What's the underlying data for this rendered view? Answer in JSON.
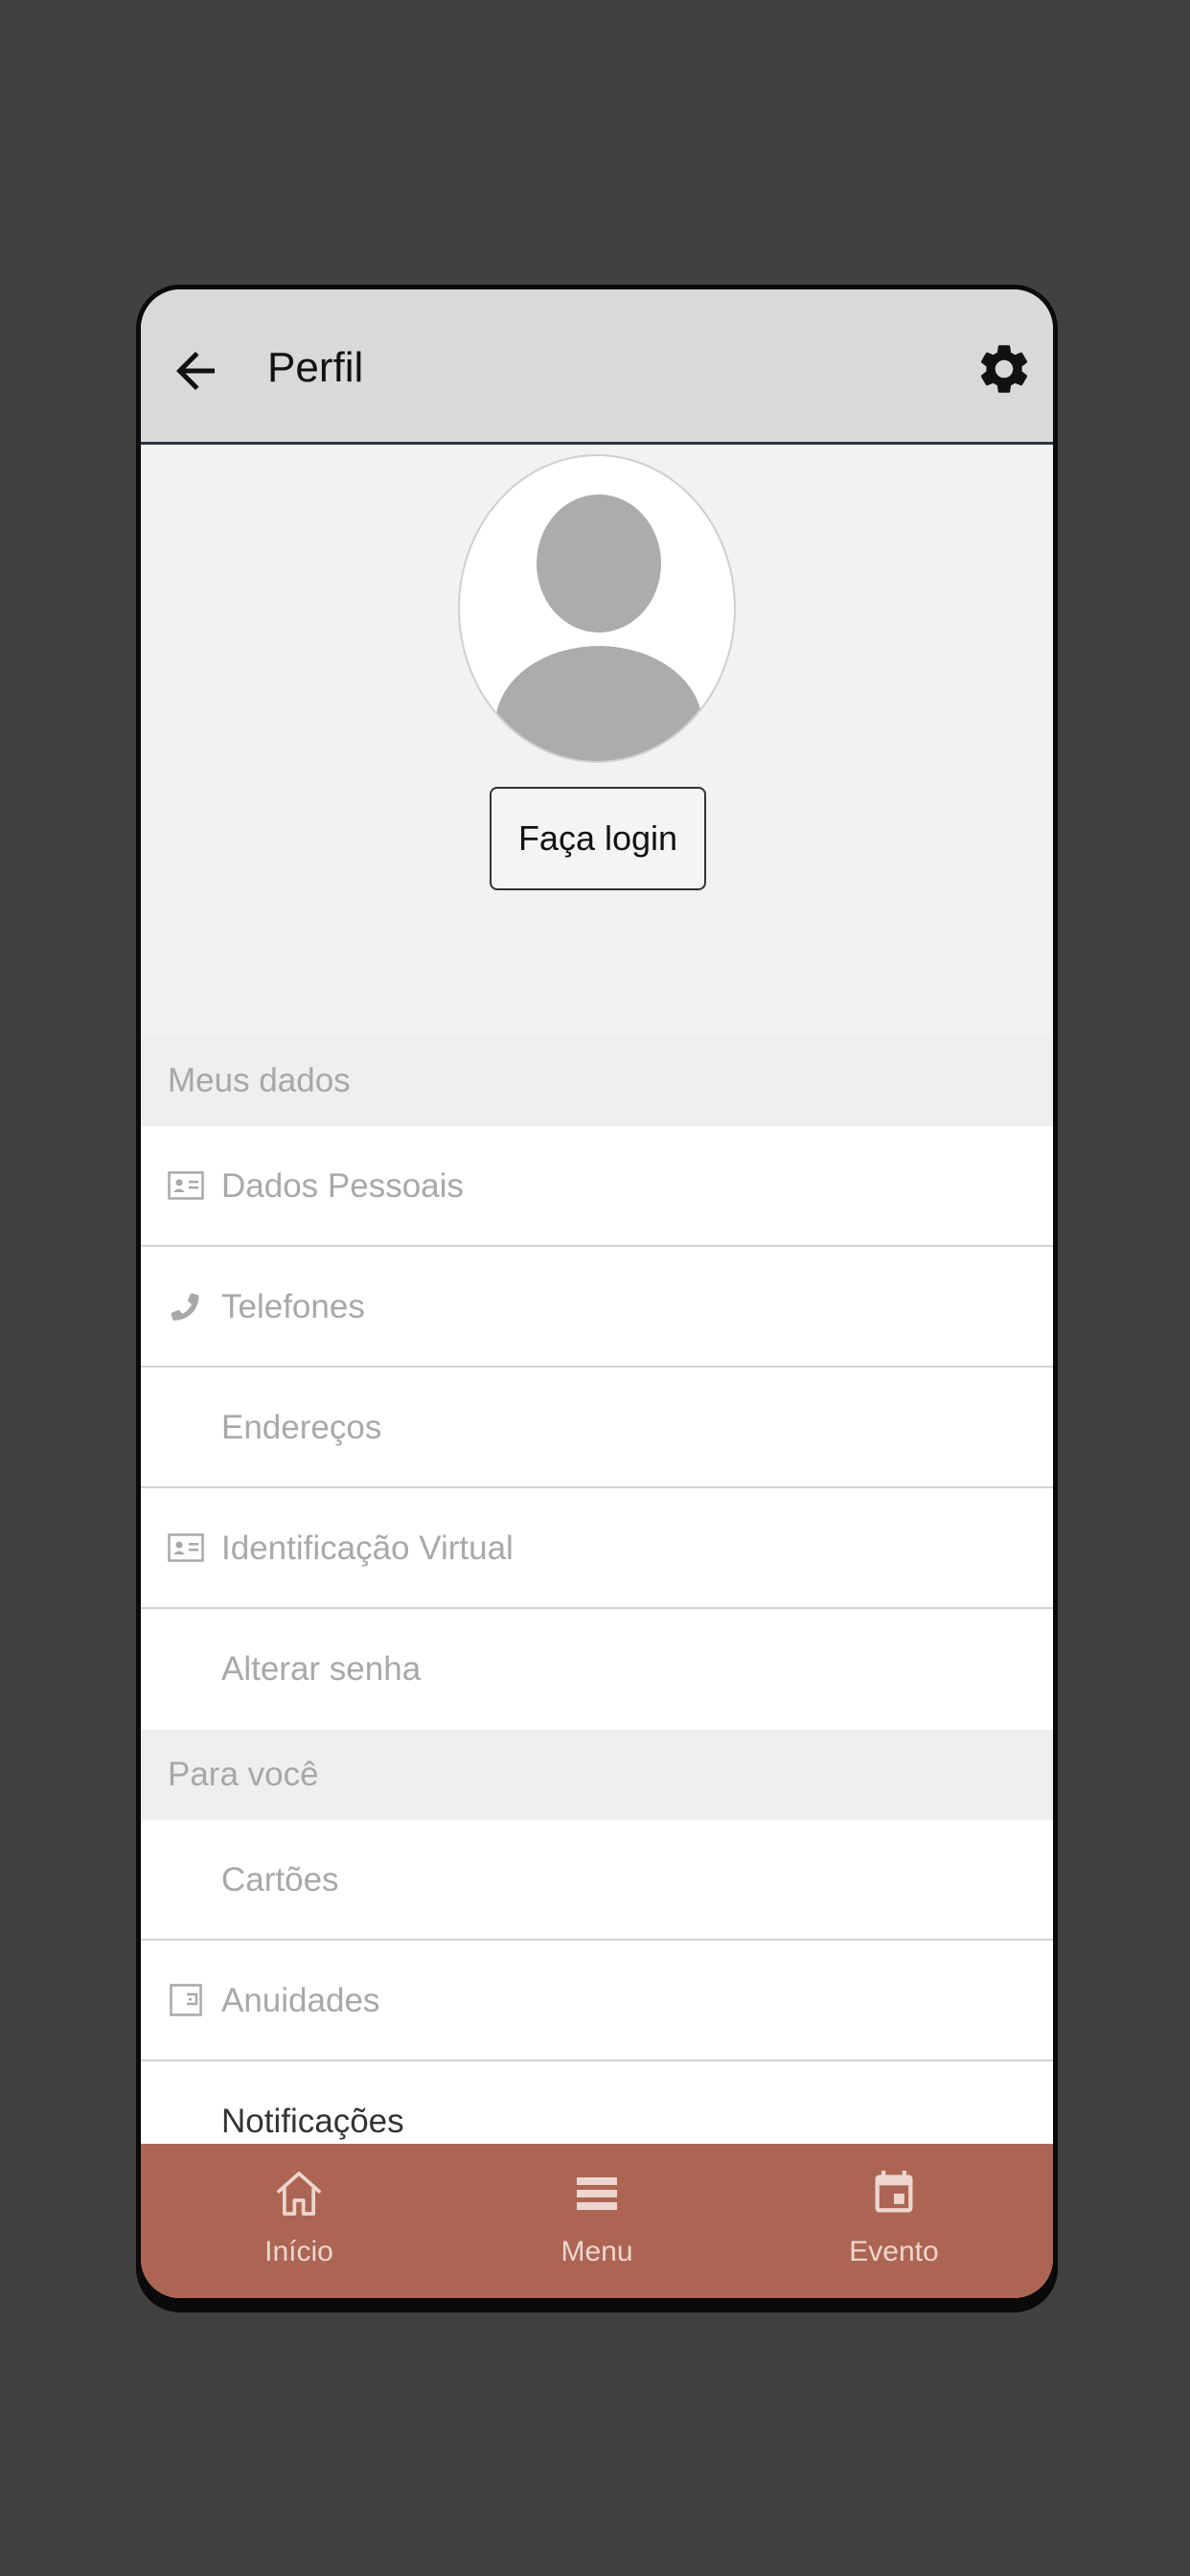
{
  "header": {
    "title": "Perfil",
    "back_icon": "arrow-left-icon",
    "settings_icon": "gear-icon"
  },
  "profile": {
    "avatar_icon": "user-avatar-icon",
    "login_label": "Faça login"
  },
  "sections": [
    {
      "title": "Meus dados",
      "items": [
        {
          "label": "Dados Pessoais",
          "icon": "id-card-icon"
        },
        {
          "label": "Telefones",
          "icon": "phone-icon"
        },
        {
          "label": "Endereços",
          "icon": ""
        },
        {
          "label": "Identificação Virtual",
          "icon": "id-card-icon"
        },
        {
          "label": "Alterar senha",
          "icon": ""
        }
      ]
    },
    {
      "title": "Para você",
      "items": [
        {
          "label": "Cartões",
          "icon": ""
        },
        {
          "label": "Anuidades",
          "icon": "wallet-icon"
        },
        {
          "label": "Notificações",
          "icon": ""
        }
      ]
    }
  ],
  "bottom_nav": [
    {
      "label": "Início",
      "icon": "home-icon"
    },
    {
      "label": "Menu",
      "icon": "menu-icon"
    },
    {
      "label": "Evento",
      "icon": "calendar-icon"
    }
  ],
  "colors": {
    "nav_background": "#ad6553",
    "nav_text": "#ecd6cf",
    "header_background": "#d9d9d9",
    "muted_text": "#a8a8a8"
  }
}
